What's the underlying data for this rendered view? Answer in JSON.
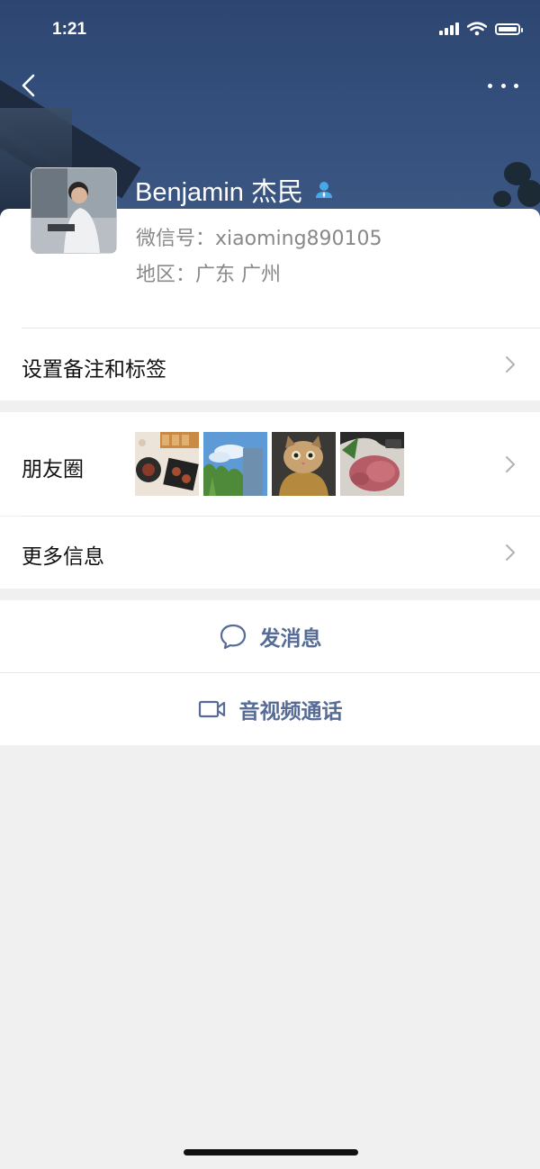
{
  "status_bar": {
    "time": "1:21"
  },
  "profile": {
    "name": "Benjamin 杰民",
    "wechat_id_label": "微信号：",
    "wechat_id": "xiaoming890105",
    "region_label": "地区：",
    "region": "广东 广州"
  },
  "menu": {
    "remark_tags": "设置备注和标签",
    "moments": "朋友圈",
    "more_info": "更多信息"
  },
  "actions": {
    "send_message": "发消息",
    "video_call": "音视频通话"
  },
  "colors": {
    "accent": "#566b95",
    "hero": "#35507d",
    "background": "#f0f0f0"
  }
}
